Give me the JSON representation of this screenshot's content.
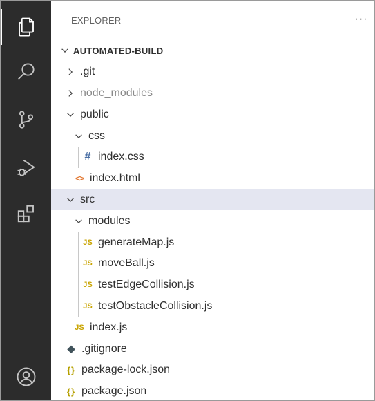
{
  "sidebar": {
    "title": "EXPLORER",
    "more_label": "···",
    "root_label": "AUTOMATED-BUILD"
  },
  "tree": [
    {
      "label": ".git",
      "type": "folder",
      "expanded": false,
      "depth": 1
    },
    {
      "label": "node_modules",
      "type": "folder",
      "expanded": false,
      "depth": 1,
      "dimmed": true
    },
    {
      "label": "public",
      "type": "folder",
      "expanded": true,
      "depth": 1
    },
    {
      "label": "css",
      "type": "folder",
      "expanded": true,
      "depth": 2
    },
    {
      "label": "index.css",
      "type": "file",
      "icon": "css-hash-icon",
      "depth": 3
    },
    {
      "label": "index.html",
      "type": "file",
      "icon": "html-icon",
      "depth": 2
    },
    {
      "label": "src",
      "type": "folder",
      "expanded": true,
      "depth": 1,
      "selected": true
    },
    {
      "label": "modules",
      "type": "folder",
      "expanded": true,
      "depth": 2
    },
    {
      "label": "generateMap.js",
      "type": "file",
      "icon": "js-icon",
      "depth": 3
    },
    {
      "label": "moveBall.js",
      "type": "file",
      "icon": "js-icon",
      "depth": 3
    },
    {
      "label": "testEdgeCollision.js",
      "type": "file",
      "icon": "js-icon",
      "depth": 3
    },
    {
      "label": "testObstacleCollision.js",
      "type": "file",
      "icon": "js-icon",
      "depth": 3
    },
    {
      "label": "index.js",
      "type": "file",
      "icon": "js-icon",
      "depth": 2
    },
    {
      "label": ".gitignore",
      "type": "file",
      "icon": "git-diamond-icon",
      "depth": 1
    },
    {
      "label": "package-lock.json",
      "type": "file",
      "icon": "json-braces-icon",
      "depth": 1
    },
    {
      "label": "package.json",
      "type": "file",
      "icon": "json-braces-icon",
      "depth": 1
    }
  ],
  "icons": {
    "js": "JS",
    "css": "#",
    "html": "<>",
    "json": "{}",
    "git": "◆"
  },
  "activity_bar": [
    {
      "name": "explorer-icon",
      "active": true
    },
    {
      "name": "search-icon"
    },
    {
      "name": "source-control-icon"
    },
    {
      "name": "run-debug-icon"
    },
    {
      "name": "extensions-icon"
    },
    {
      "name": "accounts-icon"
    }
  ],
  "colors": {
    "activity_bar_bg": "#2c2c2c",
    "activity_icon": "#c5c5c5",
    "selected_row": "#e4e6f1",
    "js_icon": "#c9a400",
    "css_icon": "#4a6fa5",
    "html_icon": "#e37933",
    "json_icon": "#b5a000",
    "gitignore_icon": "#41535b"
  }
}
